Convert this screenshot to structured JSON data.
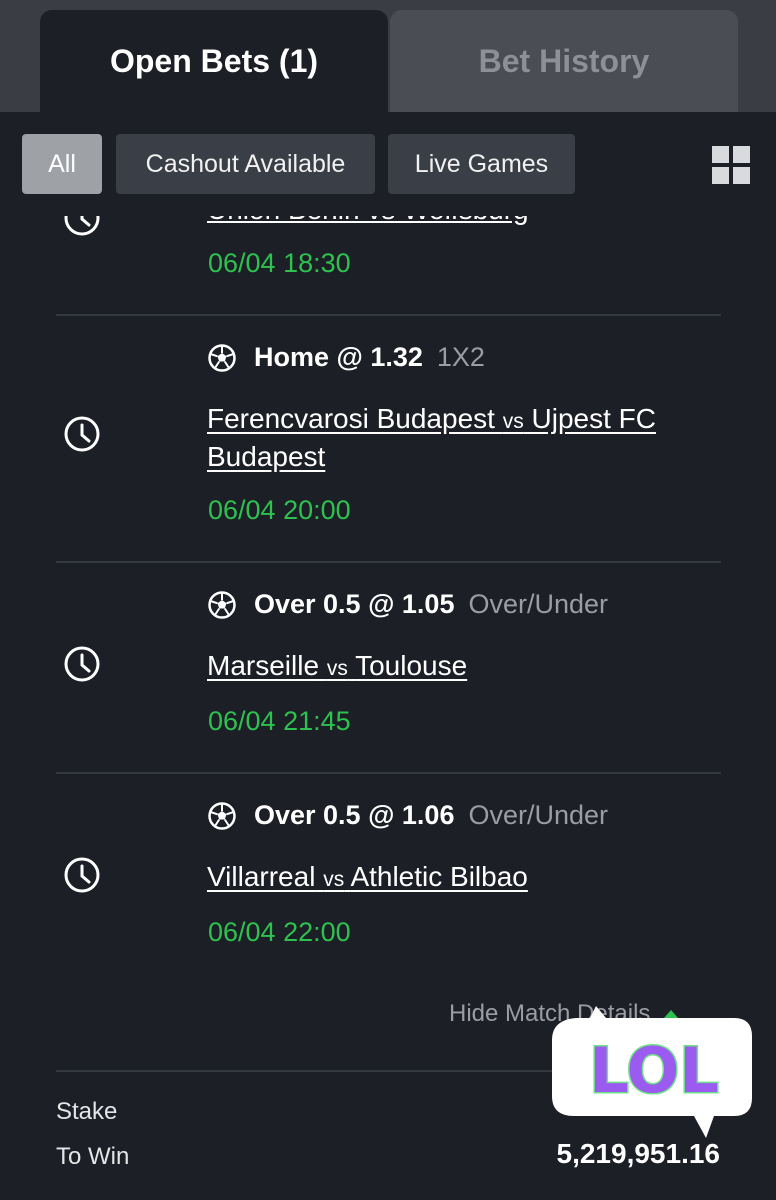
{
  "tabs": [
    {
      "label": "Open Bets (1)"
    },
    {
      "label": "Bet History"
    }
  ],
  "filters": [
    {
      "label": "All"
    },
    {
      "label": "Cashout Available"
    },
    {
      "label": "Live Games"
    }
  ],
  "cut_off_match": {
    "title": "Union Berlin vs Wolfsburg",
    "datetime": "06/04 18:30"
  },
  "selections": [
    {
      "pick": "Home @ 1.32",
      "market": "1X2",
      "home": "Ferencvarosi Budapest",
      "vs": "vs",
      "away_line1": "Ujpest FC",
      "away_line2": "Budapest",
      "datetime": "06/04 20:00"
    },
    {
      "pick": "Over 0.5 @ 1.05",
      "market": "Over/Under",
      "home": "Marseille",
      "vs": "vs",
      "away": "Toulouse",
      "datetime": "06/04 21:45"
    },
    {
      "pick": "Over 0.5 @ 1.06",
      "market": "Over/Under",
      "home": "Villarreal",
      "vs": "vs",
      "away": "Athletic Bilbao",
      "datetime": "06/04 22:00"
    }
  ],
  "hide_details_label": "Hide Match Details",
  "summary": {
    "stake_label": "Stake",
    "to_win_label": "To Win",
    "to_win_value": "5,219,951.16"
  },
  "sticker": {
    "text": "LOL"
  },
  "colors": {
    "background": "#1c1f26",
    "accent_green": "#2ec14f",
    "sticker_purple": "#9b5bf0",
    "sticker_green": "#6fe08a"
  },
  "icons": [
    "clock-icon",
    "soccer-ball-icon",
    "grid-view-icon",
    "caret-up-icon"
  ]
}
